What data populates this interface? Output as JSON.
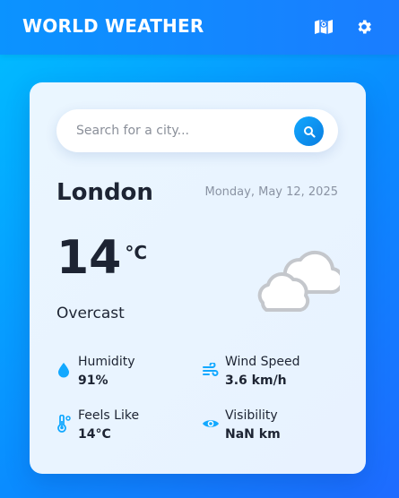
{
  "header": {
    "title": "WORLD WEATHER",
    "icons": [
      "map-icon",
      "gear-icon"
    ]
  },
  "search": {
    "placeholder": "Search for a city...",
    "value": "",
    "button_icon": "search-icon"
  },
  "current": {
    "city": "London",
    "date": "Monday, May 12, 2025",
    "temperature": "14",
    "unit": "°C",
    "condition": "Overcast",
    "weather_icon": "cloud-icon"
  },
  "details": {
    "humidity": {
      "label": "Humidity",
      "value": "91%",
      "icon": "droplet-icon"
    },
    "wind": {
      "label": "Wind Speed",
      "value": "3.6 km/h",
      "icon": "wind-icon"
    },
    "feels_like": {
      "label": "Feels Like",
      "value": "14°C",
      "icon": "thermometer-icon"
    },
    "visibility": {
      "label": "Visibility",
      "value": "NaN km",
      "icon": "eye-icon"
    }
  },
  "colors": {
    "accent": "#0a8cff",
    "icon_accent": "#12a8ff",
    "text_dark": "#1d2433",
    "text_muted": "#8a93a3"
  }
}
